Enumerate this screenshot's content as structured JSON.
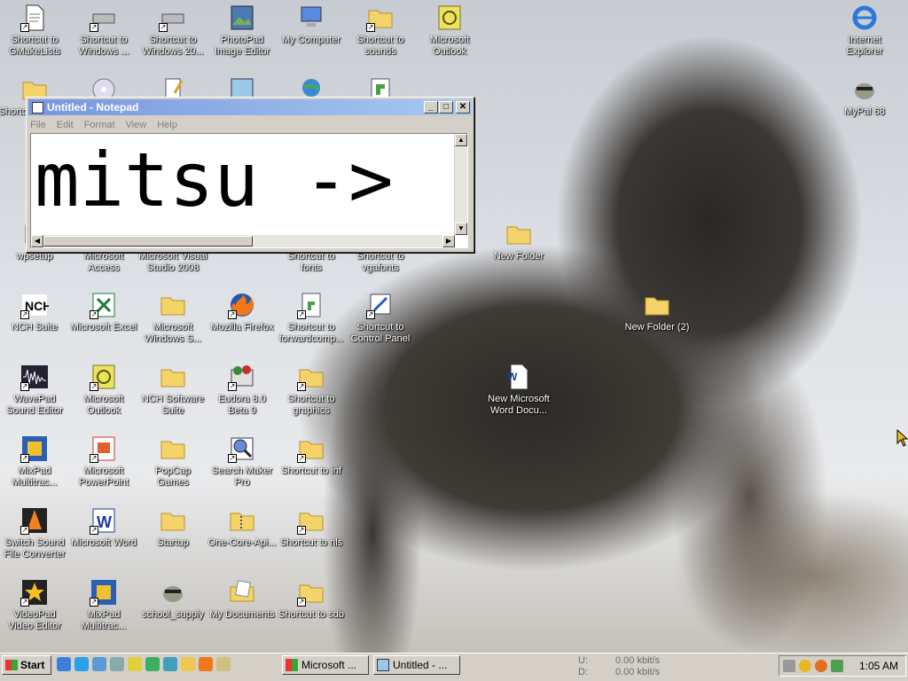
{
  "desktop": {
    "icons": {
      "c1": [
        "Shortcut to GMakeLists",
        "Shortcut",
        "",
        "wpsetup",
        "NCH Suite",
        "WavePad Sound Editor",
        "MixPad Multitrac...",
        "Switch Sound File Converter",
        "VideoPad Video Editor"
      ],
      "c2": [
        "Shortcut to Windows ...",
        "",
        "Microsoft Access",
        "Microsoft Excel",
        "Microsoft Outlook",
        "Microsoft PowerPoint",
        "Microsoft Word",
        "MixPad Multitrac..."
      ],
      "c3": [
        "Shortcut to Windows 20...",
        "",
        "Microsoft Visual Studio 2008",
        "Microsoft Windows S...",
        "NCH Software Suite",
        "PopCap Games",
        "Startup",
        "school_supply"
      ],
      "c4": [
        "PhotoPad Image Editor",
        "",
        "Mozilla Firefox",
        "Eudora 8.0 Beta 9",
        "Search Maker Pro",
        "One-Core-Api...",
        "My Documents"
      ],
      "c5": [
        "My Computer",
        "",
        "Shortcut to fonts",
        "Shortcut to forwardcomp...",
        "Shortcut to graphics",
        "Shortcut to inf",
        "Shortcut to nls",
        "Shortcut to sdb"
      ],
      "c6": [
        "Shortcut to sounds",
        "",
        "Shortcut to vgafonts",
        "Shortcut to Control Panel"
      ],
      "c7": [
        "Microsoft Outlook"
      ],
      "loose": [
        "New Folder",
        "New Folder (2)",
        "New Microsoft Word Docu..."
      ],
      "right": [
        "Internet Explorer",
        "MyPal 68"
      ]
    }
  },
  "notepad": {
    "title": "Untitled - Notepad",
    "menu": [
      "File",
      "Edit",
      "Format",
      "View",
      "Help"
    ],
    "content": "mitsu ->"
  },
  "taskbar": {
    "start_label": "Start",
    "tasks": [
      "Microsoft ...",
      "Untitled - ..."
    ],
    "net": {
      "u_label": "U:",
      "u_value": "0.00 kbit/s",
      "d_label": "D:",
      "d_value": "0.00 kbit/s"
    },
    "clock": "1:05 AM"
  },
  "colors": {
    "title_gradient_start": "#7a96df",
    "title_gradient_end": "#a6caf0",
    "taskbar": "#d4d0c8"
  }
}
